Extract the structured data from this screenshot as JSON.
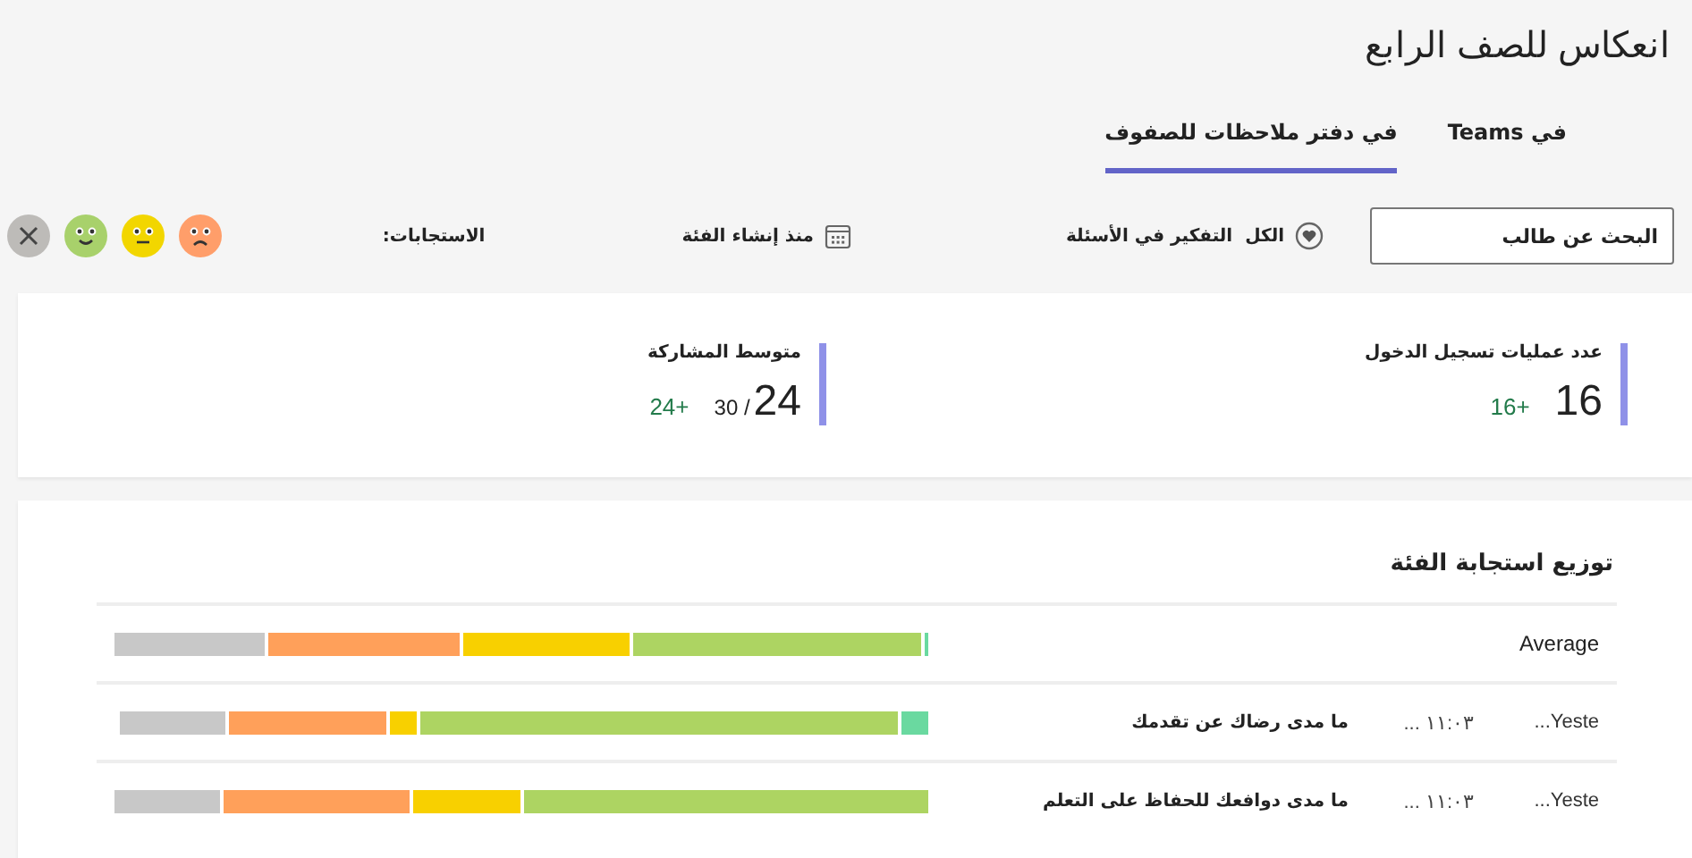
{
  "title": "انعكاس للصف الرابع",
  "tabs": [
    {
      "label": "في Teams",
      "selected": false
    },
    {
      "label": "في دفتر ملاحظات للصفوف",
      "selected": true
    }
  ],
  "search": {
    "placeholder": "البحث عن طالب"
  },
  "filters": [
    {
      "kind": "heart",
      "label": "الكل  التفكير في الأسئلة"
    },
    {
      "kind": "calendar",
      "label": "منذ إنشاء الفئة"
    }
  ],
  "responses": {
    "label": "الاستجابات:",
    "faces": [
      {
        "kind": "sad",
        "color": "#ff9e6a"
      },
      {
        "kind": "neutral",
        "color": "#f2d600"
      },
      {
        "kind": "happy",
        "color": "#a8d16b"
      },
      {
        "kind": "none",
        "color": "#bdbbb8"
      }
    ]
  },
  "stats": [
    {
      "label": "عدد عمليات تسجيل الدخول",
      "value": "16",
      "change": "+16"
    },
    {
      "label": "متوسط المشاركة",
      "value": "24",
      "suffix": "/ 30",
      "change": "+24"
    }
  ],
  "distribution": {
    "title": "توزيع استجابة الفئة",
    "rows": [
      {
        "kind": "average",
        "label": "Average",
        "segments": [
          {
            "color": "#6ad9a0"
          },
          {
            "color": "#add462"
          },
          {
            "color": "#f8d000"
          },
          {
            "color": "#ffa05a"
          },
          {
            "color": "#c8c8c8"
          }
        ]
      },
      {
        "kind": "question",
        "date": "Yeste...",
        "time": "١١:٠٣ ...",
        "question": "ما مدى رضاك عن تقدمك",
        "segments": [
          {
            "color": "#6ad9a0"
          },
          {
            "color": "#add462"
          },
          {
            "color": "#f8d000"
          },
          {
            "color": "#ffa05a"
          },
          {
            "color": "#c8c8c8"
          }
        ]
      },
      {
        "kind": "question",
        "date": "Yeste...",
        "time": "١١:٠٣ ...",
        "question": "ما مدى دوافعك للحفاظ على التعلم",
        "segments": [
          {
            "color": "#add462"
          },
          {
            "color": "#f8d000"
          },
          {
            "color": "#ffa05a"
          },
          {
            "color": "#c8c8c8"
          }
        ]
      }
    ]
  }
}
